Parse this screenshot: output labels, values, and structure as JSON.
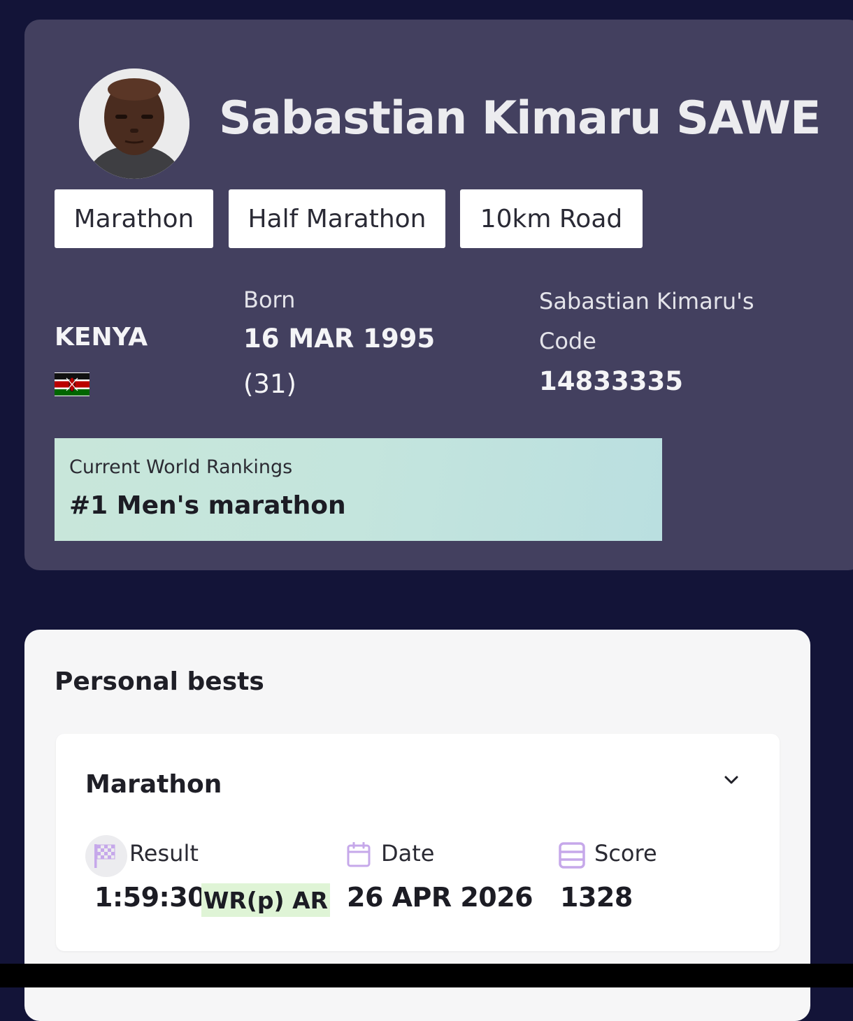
{
  "athlete": {
    "name": "Sabastian Kimaru SAWE",
    "disciplines": [
      "Marathon",
      "Half Marathon",
      "10km Road"
    ],
    "country": "KENYA",
    "born_label": "Born",
    "born_date": "16 MAR 1995",
    "age": "(31)",
    "code_label_line1": "Sabastian Kimaru's",
    "code_label_line2": "Code",
    "code_value": "14833335"
  },
  "ranking": {
    "label": "Current World Rankings",
    "value": "#1 Men's marathon"
  },
  "personal_bests": {
    "title": "Personal bests",
    "event": "Marathon",
    "result_label": "Result",
    "date_label": "Date",
    "score_label": "Score",
    "result_value": "1:59:30",
    "result_badge": "WR(p) AR",
    "date_value": "26 APR 2026",
    "score_value": "1328"
  },
  "icons": {
    "result": "checkered-flag-icon",
    "date": "calendar-icon",
    "score": "score-list-icon",
    "expand": "chevron-down-icon"
  },
  "colors": {
    "page_bg": "#131438",
    "profile_card": "#43405f",
    "ranking_bg": "#c4e5dd",
    "icon_accent": "#c6a8ea",
    "badge_bg": "#dff4d6"
  }
}
